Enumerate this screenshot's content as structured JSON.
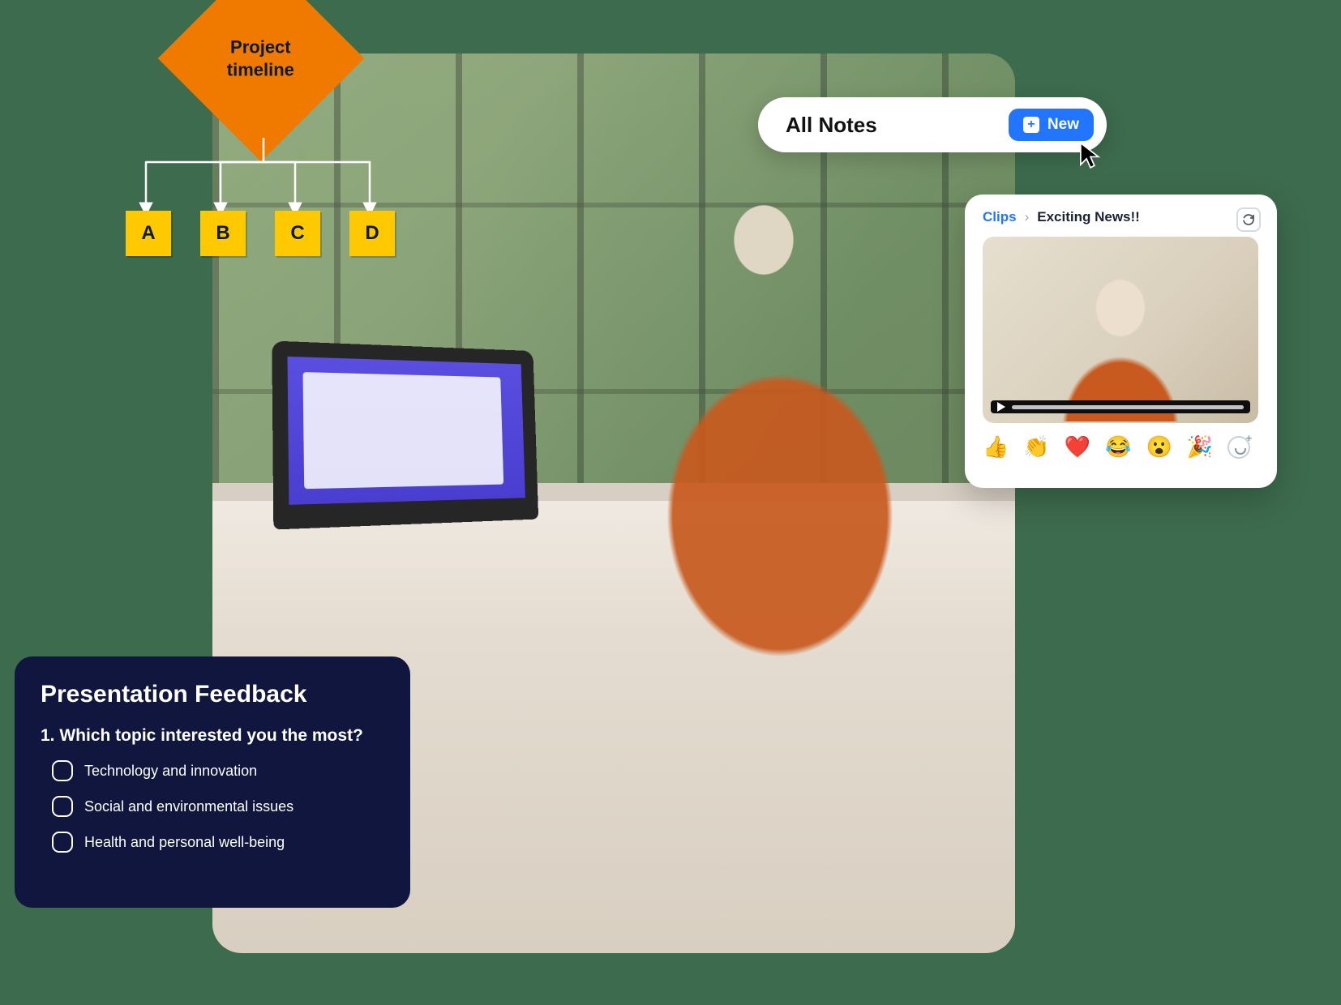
{
  "flowchart": {
    "root_label": "Project\ntimeline",
    "nodes": [
      "A",
      "B",
      "C",
      "D"
    ]
  },
  "notes_bar": {
    "title": "All Notes",
    "new_button_label": "New"
  },
  "clips_card": {
    "breadcrumb_root": "Clips",
    "breadcrumb_current": "Exciting News!!",
    "reactions": [
      "👍",
      "👏",
      "❤️",
      "😂",
      "😮",
      "🎉"
    ]
  },
  "feedback_card": {
    "title": "Presentation Feedback",
    "question_number": "1.",
    "question_text": "Which topic interested you the most?",
    "options": [
      "Technology and innovation",
      "Social and environmental issues",
      "Health and personal well-being"
    ]
  }
}
